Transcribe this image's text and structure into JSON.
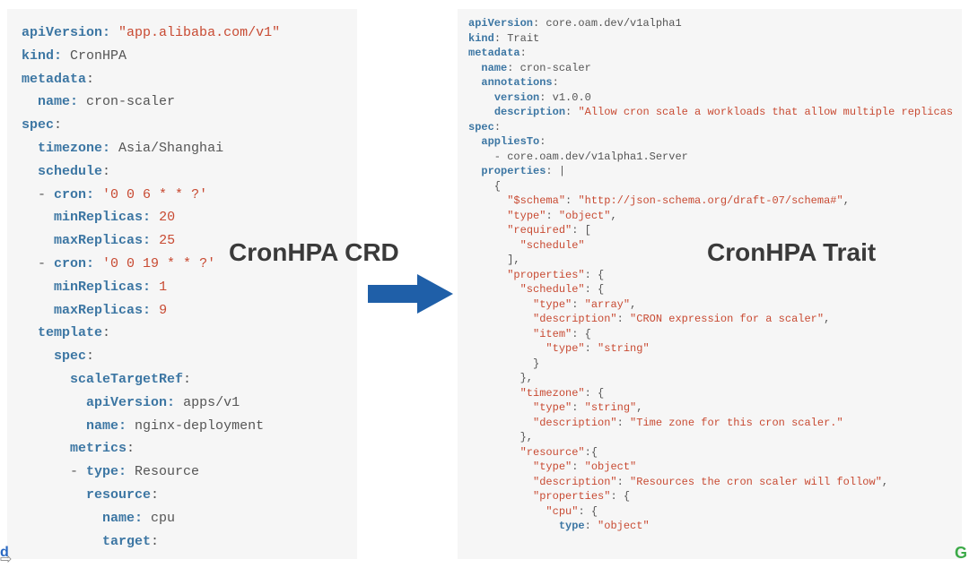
{
  "labels": {
    "left": "CronHPA CRD",
    "right": "CronHPA Trait"
  },
  "edge": {
    "left_letter": "d",
    "bottom_arrow": "⇨",
    "right_letter": "G"
  },
  "leftCode": {
    "lines": [
      [
        [
          "kw",
          "apiVersion:"
        ],
        [
          "punc",
          " "
        ],
        [
          "str",
          "\"app.alibaba.com/v1\""
        ]
      ],
      [
        [
          "kw",
          "kind:"
        ],
        [
          "punc",
          " "
        ],
        [
          "val",
          "CronHPA"
        ]
      ],
      [
        [
          "kw",
          "metadata"
        ],
        [
          "punc",
          ":"
        ]
      ],
      [
        [
          "punc",
          "  "
        ],
        [
          "kw",
          "name:"
        ],
        [
          "punc",
          " "
        ],
        [
          "val",
          "cron-scaler"
        ]
      ],
      [
        [
          "kw",
          "spec"
        ],
        [
          "punc",
          ":"
        ]
      ],
      [
        [
          "punc",
          "  "
        ],
        [
          "kw",
          "timezone:"
        ],
        [
          "punc",
          " "
        ],
        [
          "val",
          "Asia/Shanghai"
        ]
      ],
      [
        [
          "punc",
          "  "
        ],
        [
          "kw",
          "schedule"
        ],
        [
          "punc",
          ":"
        ]
      ],
      [
        [
          "punc",
          "  - "
        ],
        [
          "kw",
          "cron:"
        ],
        [
          "punc",
          " "
        ],
        [
          "str",
          "'0 0 6 * * ?'"
        ]
      ],
      [
        [
          "punc",
          "    "
        ],
        [
          "kw",
          "minReplicas:"
        ],
        [
          "punc",
          " "
        ],
        [
          "num",
          "20"
        ]
      ],
      [
        [
          "punc",
          "    "
        ],
        [
          "kw",
          "maxReplicas:"
        ],
        [
          "punc",
          " "
        ],
        [
          "num",
          "25"
        ]
      ],
      [
        [
          "punc",
          "  - "
        ],
        [
          "kw",
          "cron:"
        ],
        [
          "punc",
          " "
        ],
        [
          "str",
          "'0 0 19 * * ?'"
        ]
      ],
      [
        [
          "punc",
          "    "
        ],
        [
          "kw",
          "minReplicas:"
        ],
        [
          "punc",
          " "
        ],
        [
          "num",
          "1"
        ]
      ],
      [
        [
          "punc",
          "    "
        ],
        [
          "kw",
          "maxReplicas:"
        ],
        [
          "punc",
          " "
        ],
        [
          "num",
          "9"
        ]
      ],
      [
        [
          "punc",
          "  "
        ],
        [
          "kw",
          "template"
        ],
        [
          "punc",
          ":"
        ]
      ],
      [
        [
          "punc",
          "    "
        ],
        [
          "kw",
          "spec"
        ],
        [
          "punc",
          ":"
        ]
      ],
      [
        [
          "punc",
          "      "
        ],
        [
          "kw",
          "scaleTargetRef"
        ],
        [
          "punc",
          ":"
        ]
      ],
      [
        [
          "punc",
          "        "
        ],
        [
          "kw",
          "apiVersion:"
        ],
        [
          "punc",
          " "
        ],
        [
          "val",
          "apps/v1"
        ]
      ],
      [
        [
          "punc",
          "        "
        ],
        [
          "kw",
          "name:"
        ],
        [
          "punc",
          " "
        ],
        [
          "val",
          "nginx-deployment"
        ]
      ],
      [
        [
          "punc",
          "      "
        ],
        [
          "kw",
          "metrics"
        ],
        [
          "punc",
          ":"
        ]
      ],
      [
        [
          "punc",
          "      - "
        ],
        [
          "kw",
          "type:"
        ],
        [
          "punc",
          " "
        ],
        [
          "val",
          "Resource"
        ]
      ],
      [
        [
          "punc",
          "        "
        ],
        [
          "kw",
          "resource"
        ],
        [
          "punc",
          ":"
        ]
      ],
      [
        [
          "punc",
          "          "
        ],
        [
          "kw",
          "name:"
        ],
        [
          "punc",
          " "
        ],
        [
          "val",
          "cpu"
        ]
      ],
      [
        [
          "punc",
          "          "
        ],
        [
          "kw",
          "target"
        ],
        [
          "punc",
          ":"
        ]
      ]
    ]
  },
  "rightCode": {
    "lines": [
      [
        [
          "kw",
          "apiVersion"
        ],
        [
          "punc",
          ": "
        ],
        [
          "val",
          "core.oam.dev/v1alpha1"
        ]
      ],
      [
        [
          "kw",
          "kind"
        ],
        [
          "punc",
          ": "
        ],
        [
          "val",
          "Trait"
        ]
      ],
      [
        [
          "kw",
          "metadata"
        ],
        [
          "punc",
          ":"
        ]
      ],
      [
        [
          "punc",
          "  "
        ],
        [
          "kw",
          "name"
        ],
        [
          "punc",
          ": "
        ],
        [
          "val",
          "cron-scaler"
        ]
      ],
      [
        [
          "punc",
          "  "
        ],
        [
          "kw",
          "annotations"
        ],
        [
          "punc",
          ":"
        ]
      ],
      [
        [
          "punc",
          "    "
        ],
        [
          "kw",
          "version"
        ],
        [
          "punc",
          ": "
        ],
        [
          "val",
          "v1.0.0"
        ]
      ],
      [
        [
          "punc",
          "    "
        ],
        [
          "kw",
          "description"
        ],
        [
          "punc",
          ": "
        ],
        [
          "str",
          "\"Allow cron scale a workloads that allow multiple replicas"
        ]
      ],
      [
        [
          "kw",
          "spec"
        ],
        [
          "punc",
          ":"
        ]
      ],
      [
        [
          "punc",
          "  "
        ],
        [
          "kw",
          "appliesTo"
        ],
        [
          "punc",
          ":"
        ]
      ],
      [
        [
          "punc",
          "    - "
        ],
        [
          "val",
          "core.oam.dev/v1alpha1.Server"
        ]
      ],
      [
        [
          "punc",
          "  "
        ],
        [
          "kw",
          "properties"
        ],
        [
          "punc",
          ": |"
        ]
      ],
      [
        [
          "punc",
          "    {"
        ]
      ],
      [
        [
          "punc",
          "      "
        ],
        [
          "str",
          "\"$schema\""
        ],
        [
          "punc",
          ": "
        ],
        [
          "str",
          "\"http://json-schema.org/draft-07/schema#\""
        ],
        [
          "punc",
          ","
        ]
      ],
      [
        [
          "punc",
          "      "
        ],
        [
          "str",
          "\"type\""
        ],
        [
          "punc",
          ": "
        ],
        [
          "str",
          "\"object\""
        ],
        [
          "punc",
          ","
        ]
      ],
      [
        [
          "punc",
          "      "
        ],
        [
          "str",
          "\"required\""
        ],
        [
          "punc",
          ": ["
        ]
      ],
      [
        [
          "punc",
          "        "
        ],
        [
          "str",
          "\"schedule\""
        ]
      ],
      [
        [
          "punc",
          "      ],"
        ]
      ],
      [
        [
          "punc",
          "      "
        ],
        [
          "str",
          "\"properties\""
        ],
        [
          "punc",
          ": {"
        ]
      ],
      [
        [
          "punc",
          "        "
        ],
        [
          "str",
          "\"schedule\""
        ],
        [
          "punc",
          ": {"
        ]
      ],
      [
        [
          "punc",
          "          "
        ],
        [
          "str",
          "\"type\""
        ],
        [
          "punc",
          ": "
        ],
        [
          "str",
          "\"array\""
        ],
        [
          "punc",
          ","
        ]
      ],
      [
        [
          "punc",
          "          "
        ],
        [
          "str",
          "\"description\""
        ],
        [
          "punc",
          ": "
        ],
        [
          "str",
          "\"CRON expression for a scaler\""
        ],
        [
          "punc",
          ","
        ]
      ],
      [
        [
          "punc",
          "          "
        ],
        [
          "str",
          "\"item\""
        ],
        [
          "punc",
          ": {"
        ]
      ],
      [
        [
          "punc",
          "            "
        ],
        [
          "str",
          "\"type\""
        ],
        [
          "punc",
          ": "
        ],
        [
          "str",
          "\"string\""
        ]
      ],
      [
        [
          "punc",
          "          }"
        ]
      ],
      [
        [
          "punc",
          "        },"
        ]
      ],
      [
        [
          "punc",
          "        "
        ],
        [
          "str",
          "\"timezone\""
        ],
        [
          "punc",
          ": {"
        ]
      ],
      [
        [
          "punc",
          "          "
        ],
        [
          "str",
          "\"type\""
        ],
        [
          "punc",
          ": "
        ],
        [
          "str",
          "\"string\""
        ],
        [
          "punc",
          ","
        ]
      ],
      [
        [
          "punc",
          "          "
        ],
        [
          "str",
          "\"description\""
        ],
        [
          "punc",
          ": "
        ],
        [
          "str",
          "\"Time zone for this cron scaler.\""
        ]
      ],
      [
        [
          "punc",
          "        },"
        ]
      ],
      [
        [
          "punc",
          "        "
        ],
        [
          "str",
          "\"resource\""
        ],
        [
          "punc",
          ":{"
        ]
      ],
      [
        [
          "punc",
          "          "
        ],
        [
          "str",
          "\"type\""
        ],
        [
          "punc",
          ": "
        ],
        [
          "str",
          "\"object\""
        ]
      ],
      [
        [
          "punc",
          "          "
        ],
        [
          "str",
          "\"description\""
        ],
        [
          "punc",
          ": "
        ],
        [
          "str",
          "\"Resources the cron scaler will follow\""
        ],
        [
          "punc",
          ","
        ]
      ],
      [
        [
          "punc",
          "          "
        ],
        [
          "str",
          "\"properties\""
        ],
        [
          "punc",
          ": {"
        ]
      ],
      [
        [
          "punc",
          "            "
        ],
        [
          "str",
          "\"cpu\""
        ],
        [
          "punc",
          ": {"
        ]
      ],
      [
        [
          "punc",
          "              "
        ],
        [
          "kw",
          "type"
        ],
        [
          "punc",
          ": "
        ],
        [
          "str",
          "\"object\""
        ]
      ]
    ]
  }
}
